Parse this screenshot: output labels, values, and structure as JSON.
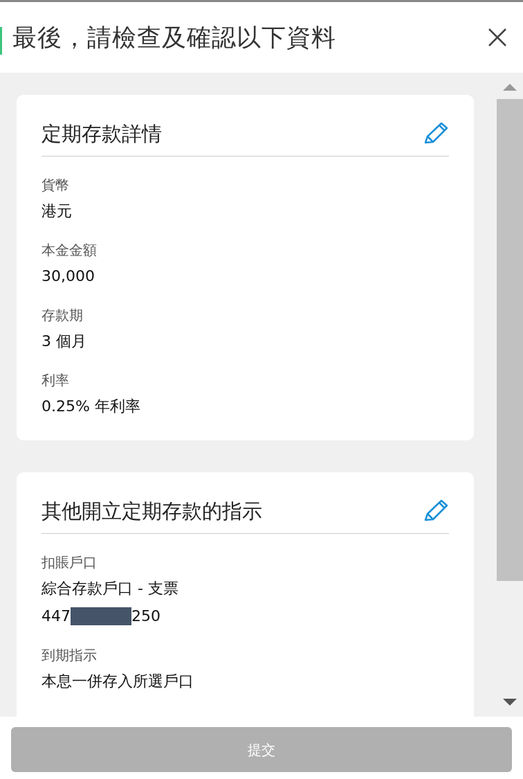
{
  "header": {
    "title": "最後，請檢查及確認以下資料"
  },
  "sections": [
    {
      "title": "定期存款詳情",
      "fields": [
        {
          "kind": "text",
          "label": "貨幣",
          "value": "港元"
        },
        {
          "kind": "text",
          "label": "本金金額",
          "value": "30,000"
        },
        {
          "kind": "text",
          "label": "存款期",
          "value": "3 個月"
        },
        {
          "kind": "text",
          "label": "利率",
          "value": "0.25% 年利率"
        }
      ]
    },
    {
      "title": "其他開立定期存款的指示",
      "fields": [
        {
          "kind": "account",
          "label": "扣賬戶口",
          "value": "綜合存款戶口 - 支票",
          "prefix": "447",
          "suffix": "250"
        },
        {
          "kind": "text",
          "label": "到期指示",
          "value": "本息一併存入所選戶口"
        }
      ]
    }
  ],
  "submit": {
    "label": "提交",
    "disabled": true
  }
}
